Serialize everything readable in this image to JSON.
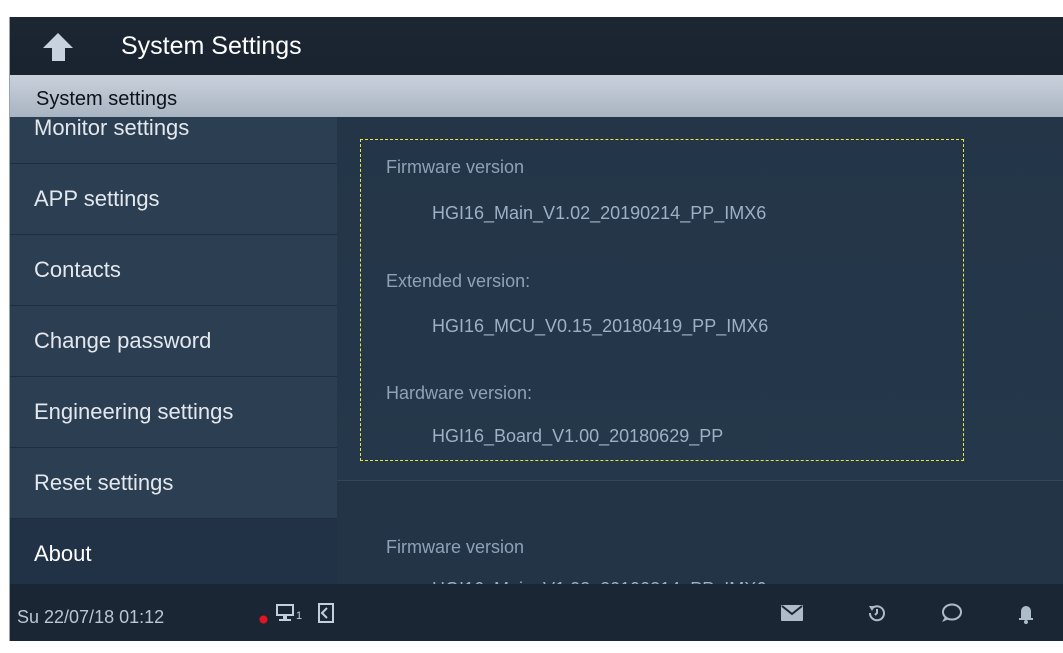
{
  "header": {
    "title": "System Settings"
  },
  "section": {
    "label": "System settings"
  },
  "sidebar": {
    "items": [
      {
        "label": "Monitor settings"
      },
      {
        "label": "APP settings"
      },
      {
        "label": "Contacts"
      },
      {
        "label": "Change password"
      },
      {
        "label": "Engineering settings"
      },
      {
        "label": "Reset settings"
      },
      {
        "label": "About"
      }
    ]
  },
  "content": {
    "firmware_label": "Firmware version",
    "firmware_value": "HGI16_Main_V1.02_20190214_PP_IMX6",
    "extended_label": "Extended version:",
    "extended_value": "HGI16_MCU_V0.15_20180419_PP_IMX6",
    "hardware_label": "Hardware version:",
    "hardware_value": "HGI16_Board_V1.00_20180629_PP",
    "firmware_label_2": "Firmware version"
  },
  "statusbar": {
    "datetime": "Su 22/07/18  01:12",
    "network_sub": "1",
    "icons": [
      "record-dot-icon",
      "network-icon",
      "door-icon",
      "mail-icon",
      "history-icon",
      "message-icon",
      "bell-icon"
    ],
    "colors": {
      "record_dot": "#e0151f"
    }
  },
  "colors": {
    "highlight_border": "#f0e33a",
    "section_bar": "#b9c3cf",
    "sidebar": "#2c3e52"
  }
}
